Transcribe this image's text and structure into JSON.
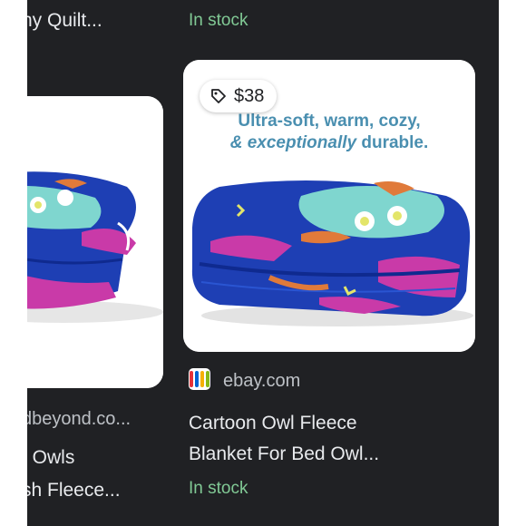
{
  "results": {
    "left_top": {
      "title_fragment": "hy Quilt...",
      "stock": "In stock"
    },
    "left": {
      "source": "dbeyond.co...",
      "title_line1": "t Owls",
      "title_line2": "sh Fleece..."
    },
    "right": {
      "price": "$38",
      "image_text_line1": "Ultra-soft, warm, cozy,",
      "image_text_line2_a": "& exceptionally",
      "image_text_line2_b": " durable.",
      "source": "ebay.com",
      "title_line1": "Cartoon Owl Fleece",
      "title_line2": "Blanket For Bed Owl...",
      "stock": "In stock"
    }
  },
  "colors": {
    "background": "#202124",
    "stock_green": "#81c995",
    "title": "#e8eaed",
    "source": "#bdc1c6",
    "blanket_blue": "#1e3fb4",
    "owl_teal": "#7fd6cf",
    "magenta": "#c93aa8",
    "orange": "#e07a3a"
  },
  "icons": {
    "price_tag": "tag-icon",
    "site_logo": "ebay-favicon-icon"
  }
}
